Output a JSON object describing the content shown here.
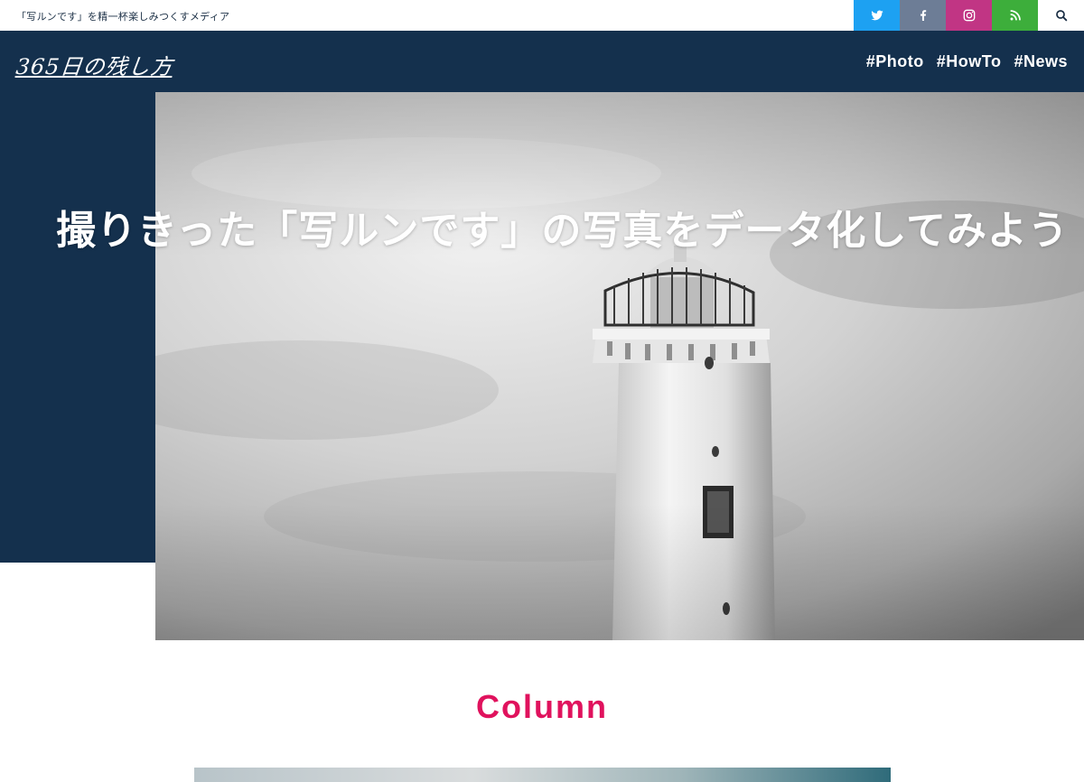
{
  "topbar": {
    "tagline": "「写ルンです」を精一杯楽しみつくすメディア",
    "social": [
      {
        "icon": "twitter-icon",
        "color": "#1da1f2"
      },
      {
        "icon": "facebook-icon",
        "color": "#6d7d96"
      },
      {
        "icon": "instagram-icon",
        "color": "#c13584"
      },
      {
        "icon": "rss-icon",
        "color": "#3dae3b"
      },
      {
        "icon": "search-icon",
        "color": "#ffffff"
      }
    ]
  },
  "header": {
    "logo": "365日の残し方",
    "nav": [
      {
        "label": "#Photo"
      },
      {
        "label": "#HowTo"
      },
      {
        "label": "#News"
      }
    ]
  },
  "hero": {
    "title": "撮りきった「写ルンです」の写真をデータ化してみよう",
    "image_icon": "lighthouse-photo"
  },
  "section": {
    "title": "Column"
  },
  "colors": {
    "navy": "#14304d",
    "accent": "#e0125d"
  }
}
